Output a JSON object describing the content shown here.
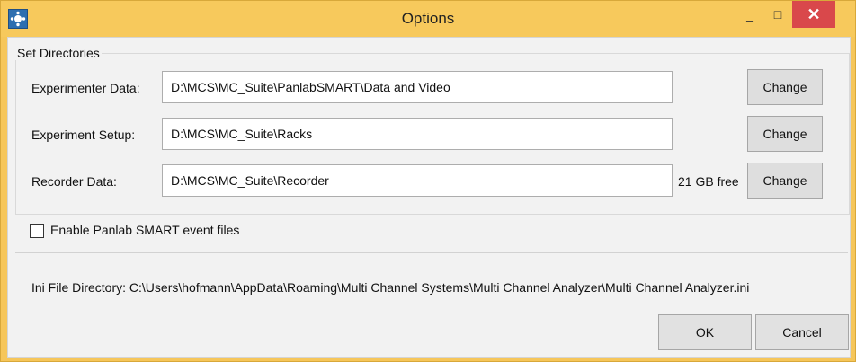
{
  "window": {
    "title": "Options",
    "minimize_icon": "_",
    "maximize_icon": "□",
    "close_icon": "✕"
  },
  "directories": {
    "group_title": "Set Directories",
    "experimenter": {
      "label": "Experimenter Data:",
      "value": "D:\\MCS\\MC_Suite\\PanlabSMART\\Data and Video",
      "button": "Change"
    },
    "setup": {
      "label": "Experiment Setup:",
      "value": "D:\\MCS\\MC_Suite\\Racks",
      "button": "Change"
    },
    "recorder": {
      "label": "Recorder Data:",
      "value": "D:\\MCS\\MC_Suite\\Recorder",
      "free": "21 GB free",
      "button": "Change"
    }
  },
  "options": {
    "enable_label": "Enable Panlab SMART event files",
    "enable_checked": false
  },
  "ini": {
    "text": "Ini File Directory:  C:\\Users\\hofmann\\AppData\\Roaming\\Multi Channel Systems\\Multi Channel Analyzer\\Multi Channel Analyzer.ini"
  },
  "buttons": {
    "ok": "OK",
    "cancel": "Cancel"
  }
}
